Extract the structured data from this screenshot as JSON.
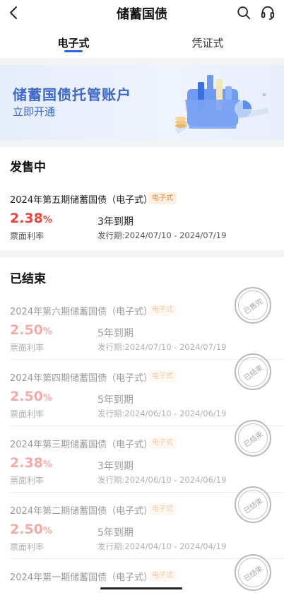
{
  "header": {
    "title": "储蓄国债"
  },
  "tabs": [
    {
      "label": "电子式"
    },
    {
      "label": "凭证式"
    }
  ],
  "banner": {
    "title": "储蓄国债托管账户",
    "subtitle": "立即开通"
  },
  "on_sale": {
    "title": "发售中",
    "items": [
      {
        "name": "2024年第五期储蓄国债（电子式）",
        "tag": "电子式",
        "rate": "2.38",
        "rate_unit": "%",
        "rate_label": "票面利率",
        "term": "3年到期",
        "period": "发行期:2024/07/10 - 2024/07/19"
      }
    ]
  },
  "ended": {
    "title": "已结束",
    "items": [
      {
        "name": "2024年第六期储蓄国债（电子式）",
        "tag": "电子式",
        "rate": "2.50",
        "rate_unit": "%",
        "rate_label": "票面利率",
        "term": "5年到期",
        "period": "发行期:2024/07/10 - 2024/07/19",
        "stamp": "已售完"
      },
      {
        "name": "2024年第四期储蓄国债（电子式）",
        "tag": "电子式",
        "rate": "2.50",
        "rate_unit": "%",
        "rate_label": "票面利率",
        "term": "5年到期",
        "period": "发行期:2024/06/10 - 2024/06/19",
        "stamp": "已结束"
      },
      {
        "name": "2024年第三期储蓄国债（电子式）",
        "tag": "电子式",
        "rate": "2.38",
        "rate_unit": "%",
        "rate_label": "票面利率",
        "term": "3年到期",
        "period": "发行期:2024/06/10 - 2024/06/19",
        "stamp": "已结束"
      },
      {
        "name": "2024年第二期储蓄国债（电子式）",
        "tag": "电子式",
        "rate": "2.50",
        "rate_unit": "%",
        "rate_label": "票面利率",
        "term": "5年到期",
        "period": "发行期:2024/04/10 - 2024/04/19",
        "stamp": "已结束"
      },
      {
        "name": "2024年第一期储蓄国债（电子式）",
        "tag": "电子式",
        "stamp": "已结束"
      }
    ]
  },
  "colors": {
    "accent": "#2c63e8",
    "rate": "#e8453c",
    "tag_text": "#e38e3a",
    "tag_bg": "#fdf0e3",
    "banner_text": "#3d67c9"
  },
  "icons": {
    "back": "chevron-left-icon",
    "search": "search-icon",
    "service": "headset-icon"
  }
}
